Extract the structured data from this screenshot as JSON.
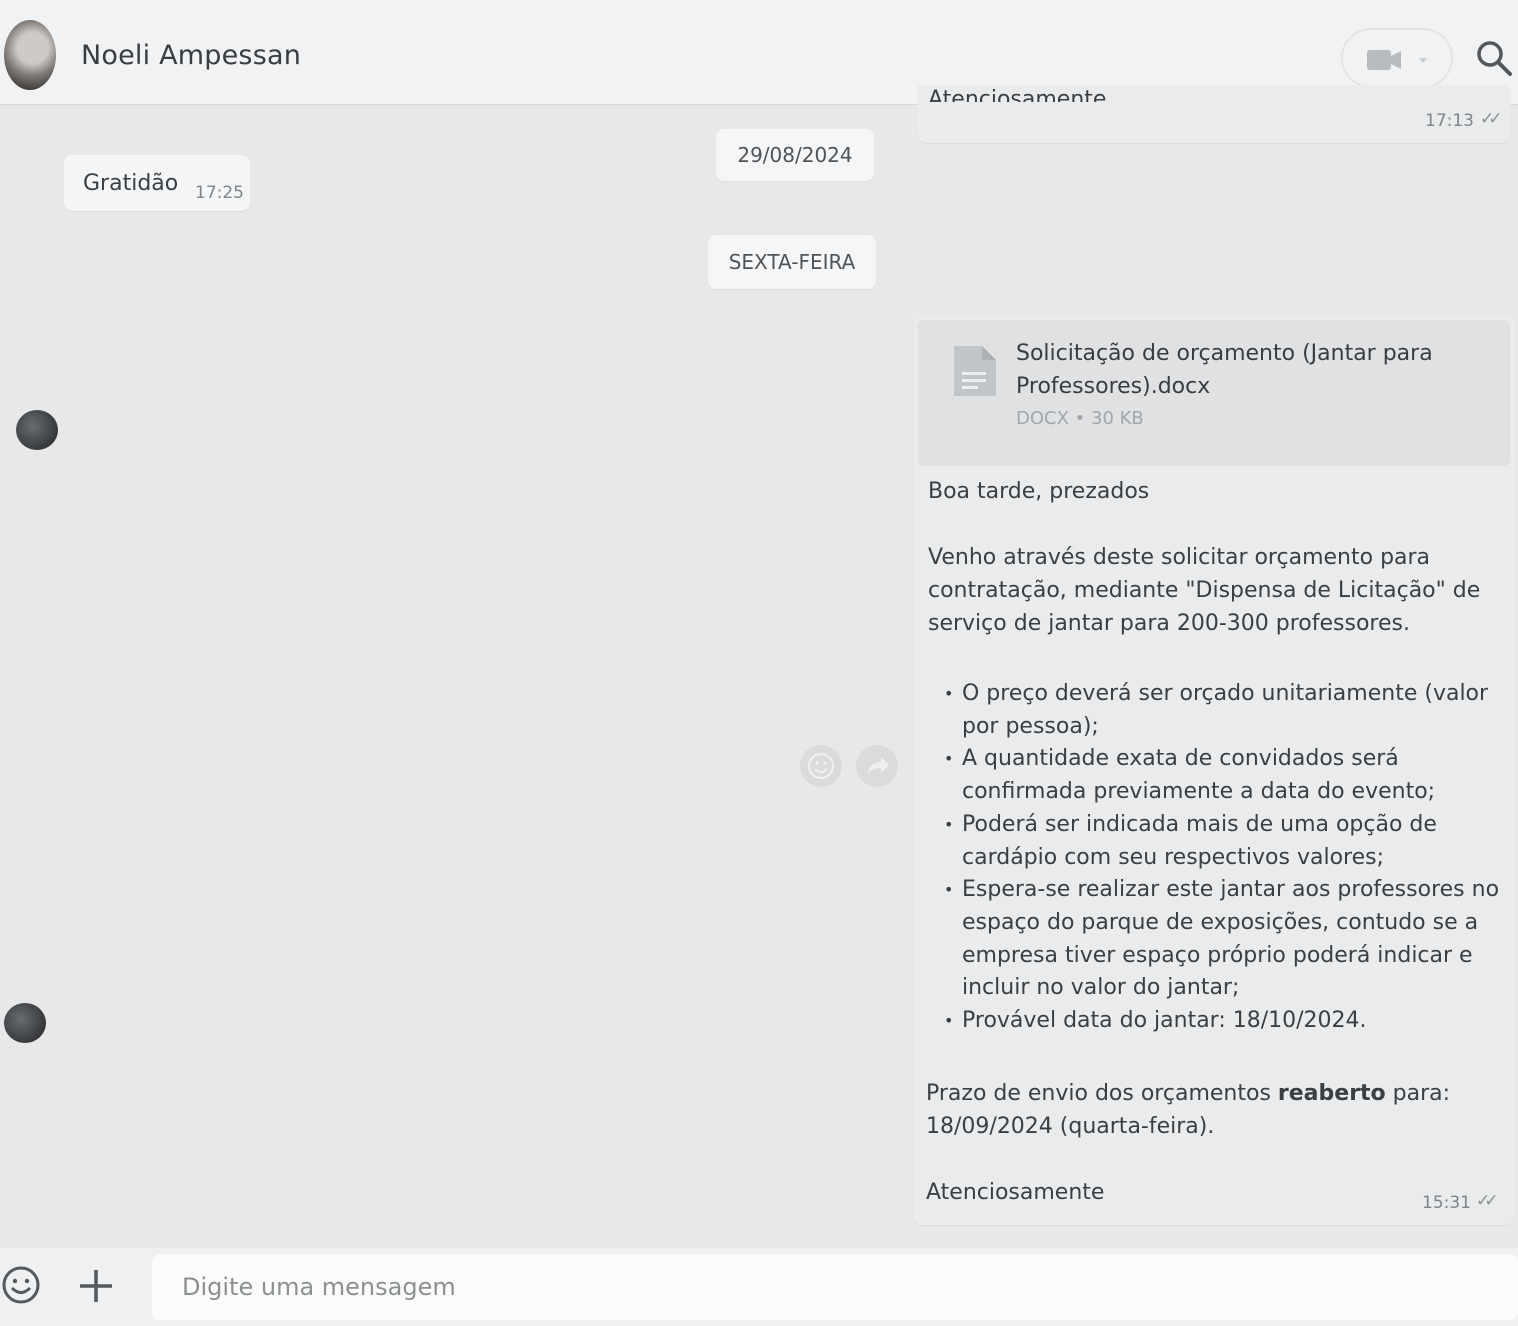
{
  "header": {
    "contact_name": "Noeli Ampessan",
    "video_icon": "video-camera-icon",
    "search_icon": "search-icon"
  },
  "chat": {
    "partial_top_message": {
      "text": "Atenciosamente",
      "time": "17:13",
      "status": "read"
    },
    "incoming_message": {
      "text": "Gratidão",
      "time": "17:25"
    },
    "date_separators": [
      "29/08/2024",
      "SEXTA-FEIRA"
    ],
    "outgoing_message": {
      "attachment": {
        "name": "Solicitação de orçamento (Jantar para Professores).docx",
        "meta": "DOCX • 30 KB",
        "icon": "document-icon"
      },
      "greeting": "Boa tarde, prezados",
      "intro": "Venho através deste solicitar orçamento para contratação, mediante \"Dispensa de Licitação\" de serviço de jantar para 200-300 professores.",
      "bullets": [
        "O preço deverá ser orçado unitariamente (valor por pessoa);",
        "A quantidade exata de convidados será confirmada previamente a data do evento;",
        "Poderá ser indicada mais de uma opção de cardápio com seu respectivos valores;",
        "Espera-se realizar este jantar aos professores no espaço do parque de exposições, contudo se a empresa tiver espaço próprio poderá indicar e incluir no valor do jantar;",
        "Provável data do jantar: 18/10/2024."
      ],
      "deadline_before": "Prazo de envio dos orçamentos",
      "deadline_bold": "reaberto",
      "deadline_after": "para: 18/09/2024 (quarta-feira).",
      "signoff": "Atenciosamente",
      "time": "15:31",
      "status": "read"
    },
    "reaction_icons": [
      "emoji-reaction-icon",
      "forward-icon"
    ]
  },
  "composer": {
    "placeholder": "Digite uma mensagem",
    "emoji_icon": "emoji-icon",
    "attach_icon": "plus-icon"
  }
}
